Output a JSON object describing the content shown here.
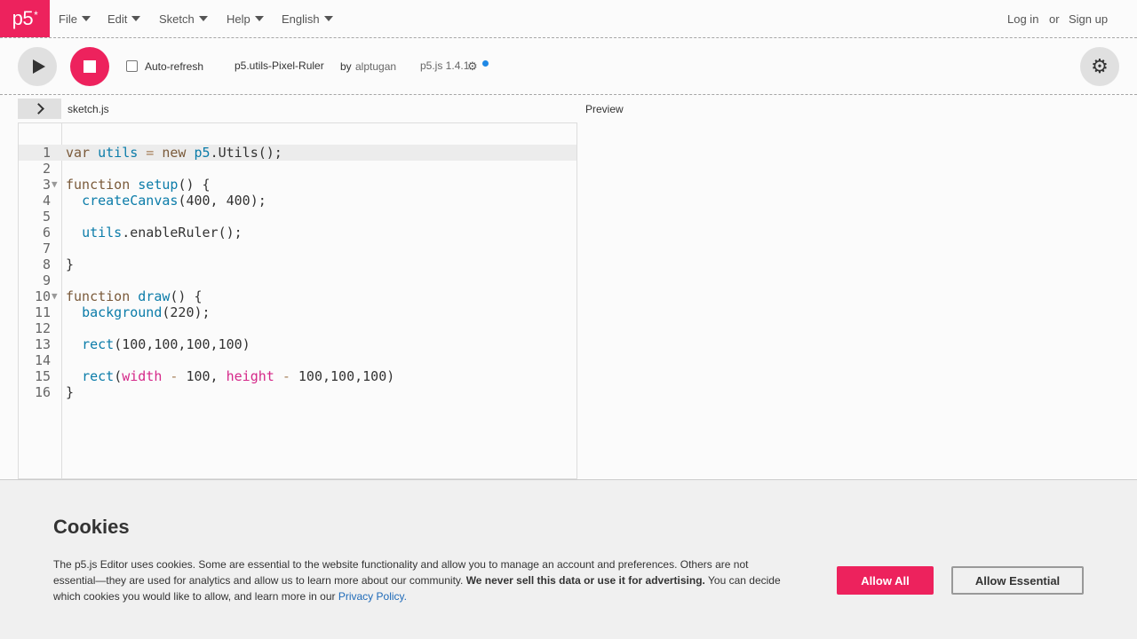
{
  "nav": {
    "logo": "p5",
    "logo_mark": "*",
    "menus": [
      "File",
      "Edit",
      "Sketch",
      "Help",
      "English"
    ],
    "login": "Log in",
    "or": "or",
    "signup": "Sign up"
  },
  "toolbar": {
    "auto_refresh_label": "Auto-refresh",
    "auto_refresh_checked": false,
    "sketch_name": "p5.utils-Pixel-Ruler",
    "by": "by",
    "author": "alptugan",
    "version": "p5.js 1.4.1"
  },
  "editor": {
    "filename": "sketch.js",
    "preview_label": "Preview",
    "lines": [
      [
        [
          "kw",
          "var "
        ],
        [
          "va",
          "utils"
        ],
        [
          "op",
          " = "
        ],
        [
          "kw",
          "new "
        ],
        [
          "va",
          "p5"
        ],
        [
          "nm",
          ".Utils();"
        ]
      ],
      [],
      [
        [
          "kw",
          "function "
        ],
        [
          "fn",
          "setup"
        ],
        [
          "nm",
          "() {"
        ]
      ],
      [
        [
          "nm",
          "  "
        ],
        [
          "fn",
          "createCanvas"
        ],
        [
          "nm",
          "(400, 400);"
        ]
      ],
      [],
      [
        [
          "nm",
          "  "
        ],
        [
          "va",
          "utils"
        ],
        [
          "nm",
          ".enableRuler();"
        ]
      ],
      [],
      [
        [
          "nm",
          "}"
        ]
      ],
      [],
      [
        [
          "kw",
          "function "
        ],
        [
          "fn",
          "draw"
        ],
        [
          "nm",
          "() {"
        ]
      ],
      [
        [
          "nm",
          "  "
        ],
        [
          "fn",
          "background"
        ],
        [
          "nm",
          "(220);"
        ]
      ],
      [],
      [
        [
          "nm",
          "  "
        ],
        [
          "fn",
          "rect"
        ],
        [
          "nm",
          "(100,100,100,100)"
        ]
      ],
      [],
      [
        [
          "nm",
          "  "
        ],
        [
          "fn",
          "rect"
        ],
        [
          "nm",
          "("
        ],
        [
          "pk",
          "width"
        ],
        [
          "op",
          " - "
        ],
        [
          "nm",
          "100, "
        ],
        [
          "pk",
          "height"
        ],
        [
          "op",
          " - "
        ],
        [
          "nm",
          "100,100,100)"
        ]
      ],
      [
        [
          "nm",
          "}"
        ]
      ]
    ],
    "fold_lines": [
      3,
      10
    ]
  },
  "cookies": {
    "title": "Cookies",
    "text1": "The p5.js Editor uses cookies. Some are essential to the website functionality and allow you to manage an account and preferences. Others are not essential—they are used for analytics and allow us to learn more about our community. ",
    "bold": "We never sell this data or use it for advertising.",
    "text2": " You can decide which cookies you would like to allow, and learn more in our ",
    "link": "Privacy Policy.",
    "allow_all": "Allow All",
    "allow_essential": "Allow Essential"
  },
  "colors": {
    "accent": "#ed225d",
    "link": "#1e6ab8",
    "notification_dot": "#1e88e5"
  }
}
